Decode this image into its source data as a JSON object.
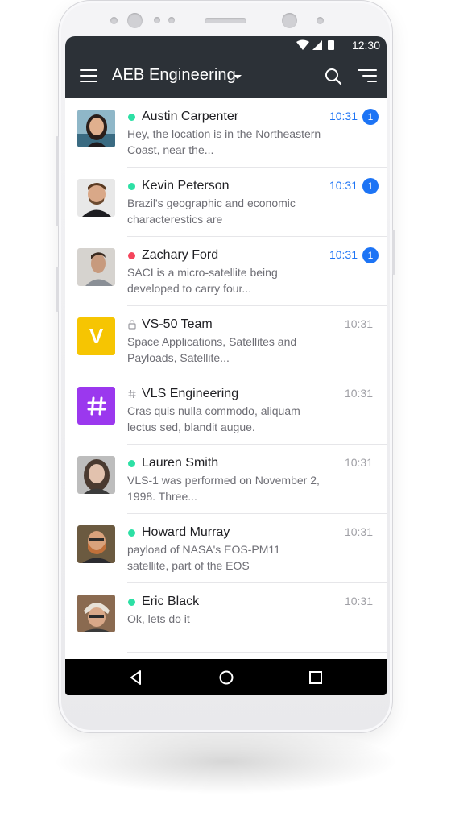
{
  "statusbar": {
    "time": "12:30"
  },
  "appbar": {
    "title": "AEB Engineering"
  },
  "colors": {
    "online": "#2de0a5",
    "busy": "#f5455c",
    "unread": "#1d74f5",
    "appbar": "#2c3137"
  },
  "rooms": [
    {
      "name": "Austin Carpenter",
      "kind": "user",
      "status": "online",
      "preview": "Hey, the location is in the Northeastern Coast, near the...",
      "time": "10:31",
      "unread": "1"
    },
    {
      "name": "Kevin Peterson",
      "kind": "user",
      "status": "online",
      "preview": "Brazil's geographic and economic characterestics are",
      "time": "10:31",
      "unread": "1"
    },
    {
      "name": "Zachary Ford",
      "kind": "user",
      "status": "busy",
      "preview": "SACI is a micro-satellite being developed to carry four...",
      "time": "10:31",
      "unread": "1"
    },
    {
      "name": "VS-50 Team",
      "kind": "private-group",
      "avatar_letter": "V",
      "avatar_color": "#f6c502",
      "preview": "Space Applications, Satellites  and Payloads, Satellite...",
      "time": "10:31",
      "unread": ""
    },
    {
      "name": "VLS Engineering",
      "kind": "channel",
      "avatar_color": "#9b38ee",
      "preview": "Cras quis nulla commodo, aliquam lectus sed, blandit augue.",
      "time": "10:31",
      "unread": ""
    },
    {
      "name": "Lauren Smith",
      "kind": "user",
      "status": "online",
      "preview": "VLS-1 was performed on November 2, 1998. Three...",
      "time": "10:31",
      "unread": ""
    },
    {
      "name": "Howard Murray",
      "kind": "user",
      "status": "online",
      "preview": "payload of NASA's EOS-PM11 satellite, part of the EOS",
      "time": "10:31",
      "unread": ""
    },
    {
      "name": "Eric Black",
      "kind": "user",
      "status": "online",
      "preview": "Ok, lets do it",
      "time": "10:31",
      "unread": ""
    }
  ],
  "navbar": {
    "icons": [
      "back-icon",
      "home-icon",
      "recents-icon"
    ]
  }
}
